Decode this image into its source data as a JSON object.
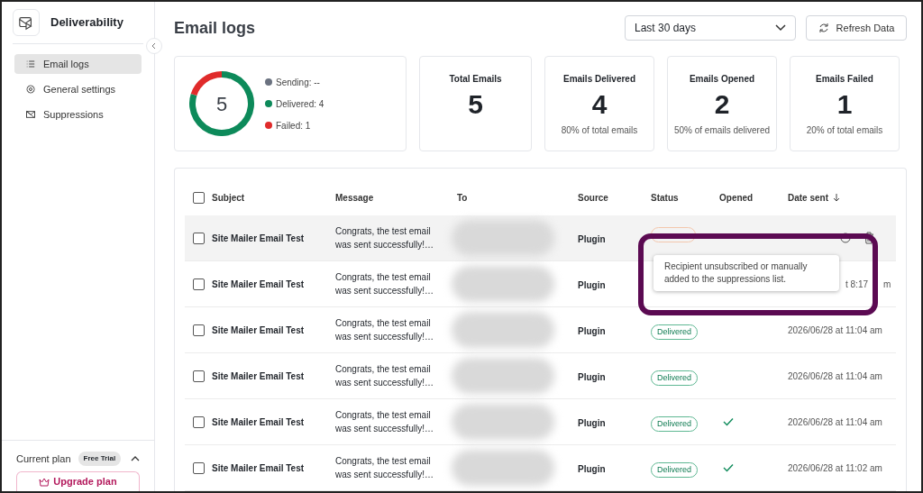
{
  "sidebar": {
    "app_name": "Deliverability",
    "items": [
      {
        "label": "Email logs",
        "selected": true
      },
      {
        "label": "General settings",
        "selected": false
      },
      {
        "label": "Suppressions",
        "selected": false
      }
    ],
    "plan": {
      "label": "Current plan",
      "badge": "Free Trial",
      "button": "Upgrade plan"
    }
  },
  "header": {
    "title": "Email logs",
    "range": "Last 30 days",
    "refresh": "Refresh Data"
  },
  "summary": {
    "total": "5",
    "legend": [
      {
        "label": "Sending: --",
        "color": "#6b7280"
      },
      {
        "label": "Delivered: 4",
        "color": "#0d8a5a"
      },
      {
        "label": "Failed: 1",
        "color": "#e02b2b"
      }
    ],
    "chart_data": {
      "type": "donut",
      "values": [
        80,
        20
      ]
    }
  },
  "stats": [
    {
      "title": "Total Emails",
      "value": "5"
    },
    {
      "title": "Emails Delivered",
      "value": "4",
      "note": "80% of total emails"
    },
    {
      "title": "Emails Opened",
      "value": "2",
      "note": "50% of emails delivered"
    },
    {
      "title": "Emails Failed",
      "value": "1",
      "note": "20% of total emails"
    }
  ],
  "table": {
    "columns": [
      "Subject",
      "Message",
      "To",
      "Source",
      "Status",
      "Opened",
      "Date sent"
    ],
    "all_checked": false,
    "rows": [
      {
        "checked": false,
        "subject": "Site Mailer Email Test",
        "message": "Congrats, the test email was sent successfully!…",
        "source": "Plugin",
        "kind": "failed",
        "opened": false,
        "date_parts": [],
        "hovered": true
      },
      {
        "checked": false,
        "subject": "Site Mailer Email Test",
        "message": "Congrats, the test email was sent successfully!…",
        "source": "Plugin",
        "opened": false,
        "date_parts": [
          "t 8:17",
          "m"
        ],
        "hovered": false
      },
      {
        "checked": false,
        "subject": "Site Mailer Email Test",
        "message": "Congrats, the test email was sent successfully!…",
        "source": "Plugin",
        "status": "Delivered",
        "kind": "delivered",
        "opened": false,
        "date_parts": [
          "2026/06/28 at 11:04 am"
        ],
        "hovered": false
      },
      {
        "checked": false,
        "subject": "Site Mailer Email Test",
        "message": "Congrats, the test email was sent successfully!…",
        "source": "Plugin",
        "status": "Delivered",
        "kind": "delivered",
        "opened": false,
        "date_parts": [
          "2026/06/28 at 11:04 am"
        ],
        "hovered": false
      },
      {
        "checked": false,
        "subject": "Site Mailer Email Test",
        "message": "Congrats, the test email was sent successfully!…",
        "source": "Plugin",
        "status": "Delivered",
        "kind": "delivered",
        "opened": true,
        "date_parts": [
          "2026/06/28 at 11:04 am"
        ],
        "hovered": false
      },
      {
        "checked": false,
        "subject": "Site Mailer Email Test",
        "message": "Congrats, the test email was sent successfully!…",
        "source": "Plugin",
        "status": "Delivered",
        "kind": "delivered",
        "opened": true,
        "date_parts": [
          "2026/06/28 at 11:02 am"
        ],
        "hovered": false
      }
    ]
  },
  "tooltip": "Recipient unsubscribed or manually added to the suppressions list."
}
